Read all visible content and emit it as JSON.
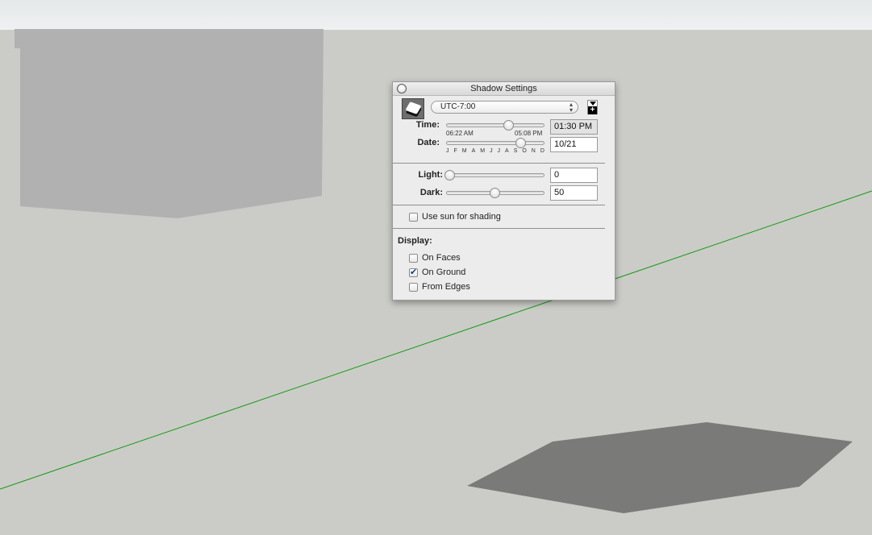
{
  "window": {
    "title": "Shadow Settings"
  },
  "timezone": {
    "selected": "UTC-7:00"
  },
  "time": {
    "label": "Time:",
    "value": "01:30 PM",
    "sunrise": "06:22 AM",
    "sunset": "05:08 PM",
    "slider_fraction": 0.65
  },
  "date": {
    "label": "Date:",
    "value": "10/21",
    "months": [
      "J",
      "F",
      "M",
      "A",
      "M",
      "J",
      "J",
      "A",
      "S",
      "O",
      "N",
      "D"
    ],
    "slider_fraction": 0.79
  },
  "light": {
    "label": "Light:",
    "value": "0",
    "slider_percent": 0
  },
  "dark": {
    "label": "Dark:",
    "value": "50",
    "slider_percent": 50
  },
  "use_sun": {
    "label": "Use sun for shading",
    "checked": false
  },
  "display": {
    "heading": "Display:",
    "options": [
      {
        "label": "On Faces",
        "checked": false
      },
      {
        "label": "On Ground",
        "checked": true
      },
      {
        "label": "From Edges",
        "checked": false
      }
    ]
  },
  "icons": {
    "close": "close-circle",
    "shadow": "shadow-settings-icon",
    "add": "add-scene-icon"
  },
  "colors": {
    "ground": "#cbccc7",
    "sky": "#e9ecec",
    "wall_shadow": "#b1b1b1",
    "ground_shadow": "#7a7a78",
    "axis": "#119911"
  }
}
